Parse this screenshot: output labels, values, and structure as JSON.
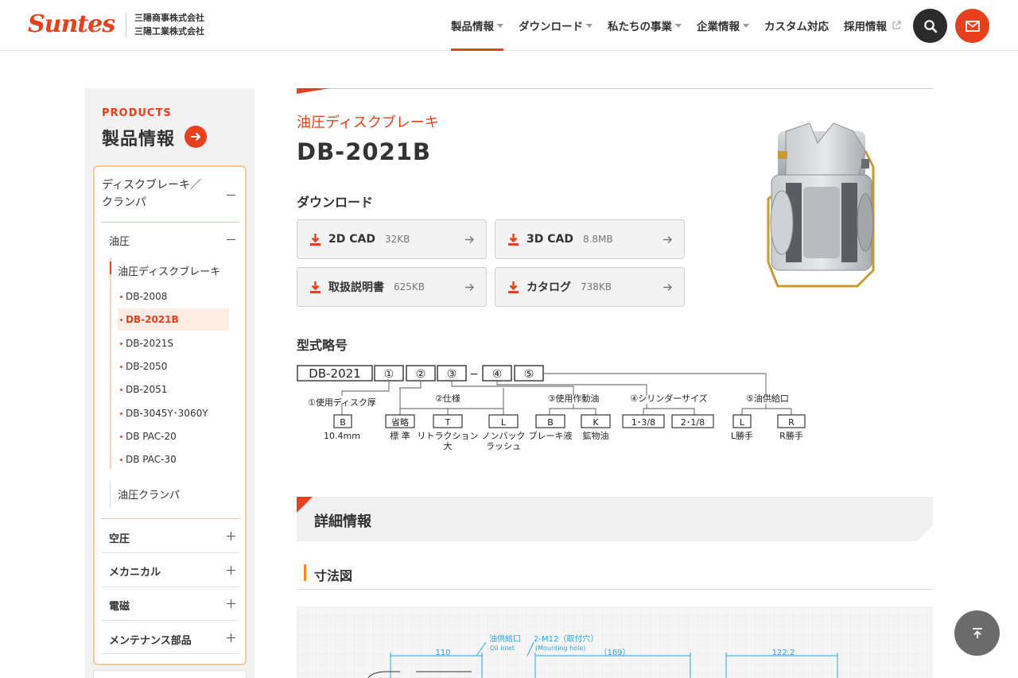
{
  "header": {
    "logo": "Suntes",
    "company_line1": "三陽商事株式会社",
    "company_line2": "三陽工業株式会社",
    "nav": [
      {
        "label": "製品情報"
      },
      {
        "label": "ダウンロード"
      },
      {
        "label": "私たちの事業"
      },
      {
        "label": "企業情報"
      },
      {
        "label": "カスタム対応"
      },
      {
        "label": "採用情報"
      }
    ]
  },
  "sidebar": {
    "en_label": "PRODUCTS",
    "title": "製品情報",
    "category": "ディスクブレーキ／クランパ",
    "category_line1": "ディスクブレーキ／",
    "category_line2": "クランパ",
    "sub_category": "油圧",
    "group_active": "油圧ディスクブレーキ",
    "items": [
      {
        "label": "DB-2008"
      },
      {
        "label": "DB-2021B"
      },
      {
        "label": "DB-2021S"
      },
      {
        "label": "DB-2050"
      },
      {
        "label": "DB-2051"
      },
      {
        "label": "DB-3045Y･3060Y"
      },
      {
        "label": "DB PAC-20"
      },
      {
        "label": "DB PAC-30"
      }
    ],
    "group_other": "油圧クランパ",
    "categories": [
      {
        "label": "空圧"
      },
      {
        "label": "メカニカル"
      },
      {
        "label": "電磁"
      },
      {
        "label": "メンテナンス部品"
      }
    ]
  },
  "product": {
    "category": "油圧ディスクブレーキ",
    "model": "DB-2021B"
  },
  "downloads": {
    "heading": "ダウンロード",
    "files": [
      {
        "label": "2D CAD",
        "size": "32KB"
      },
      {
        "label": "3D CAD",
        "size": "8.8MB"
      },
      {
        "label": "取扱説明書",
        "size": "625KB"
      },
      {
        "label": "カタログ",
        "size": "738KB"
      }
    ]
  },
  "model_code": {
    "heading": "型式略号",
    "base": "DB-2021",
    "slots": [
      "①",
      "②",
      "③",
      "④",
      "⑤"
    ],
    "dash": "−",
    "groups": [
      {
        "title": "①使用ディスク厚",
        "options": [
          {
            "code": "B",
            "desc": "10.4mm"
          }
        ]
      },
      {
        "title": "②仕様",
        "options": [
          {
            "code": "省略",
            "desc": "標 準"
          },
          {
            "code": "T",
            "desc": "リトラクション",
            "desc2": "大"
          },
          {
            "code": "L",
            "desc": "ノンバック",
            "desc2": "ラッシュ"
          }
        ]
      },
      {
        "title": "③使用作動油",
        "options": [
          {
            "code": "B",
            "desc": "ブレーキ液"
          },
          {
            "code": "K",
            "desc": "鉱物油"
          }
        ]
      },
      {
        "title": "④シリンダーサイズ",
        "options": [
          {
            "code": "1･3/8",
            "desc": ""
          },
          {
            "code": "2･1/8",
            "desc": ""
          }
        ]
      },
      {
        "title": "⑤油供給口",
        "options": [
          {
            "code": "L",
            "desc": "L勝手"
          },
          {
            "code": "R",
            "desc": "R勝手"
          }
        ]
      }
    ]
  },
  "detail": {
    "heading": "詳細情報",
    "dimension_heading": "寸法図",
    "drawing": {
      "oil_inlet_jp": "油供給口",
      "oil_inlet_en": "Oil inlet",
      "mounting_jp": "2-M12（取付穴）",
      "mounting_en": "(Mounting hole)",
      "dim1": "110",
      "dim2": "（169）",
      "dim3": "122.2"
    }
  },
  "colors": {
    "accent": "#e8401c",
    "sidebar_bg": "#f2f2f2",
    "drawing_line": "#2aa5e0"
  },
  "icons": [
    "search-icon",
    "mail-icon",
    "arrow-right-icon",
    "download-icon",
    "external-link-icon",
    "back-to-top-icon"
  ]
}
